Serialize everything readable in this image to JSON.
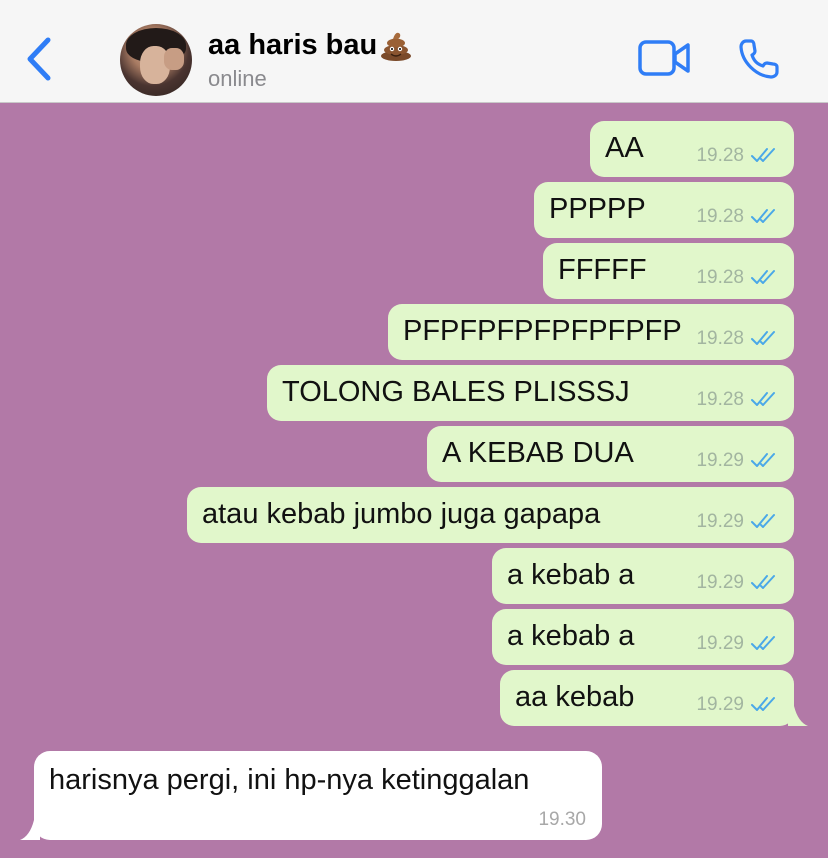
{
  "header": {
    "contact_name": "aa haris bau",
    "status": "online",
    "accent_color": "#2f7df6"
  },
  "messages_out": [
    {
      "text": "AA",
      "time": "19.28",
      "read": true
    },
    {
      "text": "PPPPP",
      "time": "19.28",
      "read": true
    },
    {
      "text": "FFFFF",
      "time": "19.28",
      "read": true
    },
    {
      "text": "PFPFPFPFPFPFPFP",
      "time": "19.28",
      "read": true
    },
    {
      "text": "TOLONG BALES PLISSSJ",
      "time": "19.28",
      "read": true
    },
    {
      "text": "A KEBAB DUA",
      "time": "19.29",
      "read": true
    },
    {
      "text": "atau kebab jumbo juga gapapa",
      "time": "19.29",
      "read": true
    },
    {
      "text": "a kebab a",
      "time": "19.29",
      "read": true
    },
    {
      "text": "a kebab a",
      "time": "19.29",
      "read": true
    },
    {
      "text": "aa kebab",
      "time": "19.29",
      "read": true
    }
  ],
  "message_in": {
    "text": "harisnya pergi, ini hp-nya ketinggalan",
    "time": "19.30"
  },
  "colors": {
    "chat_background": "#b279a7",
    "outgoing_bubble": "#e1f7cb",
    "incoming_bubble": "#ffffff",
    "read_ticks": "#4aa8e8"
  }
}
